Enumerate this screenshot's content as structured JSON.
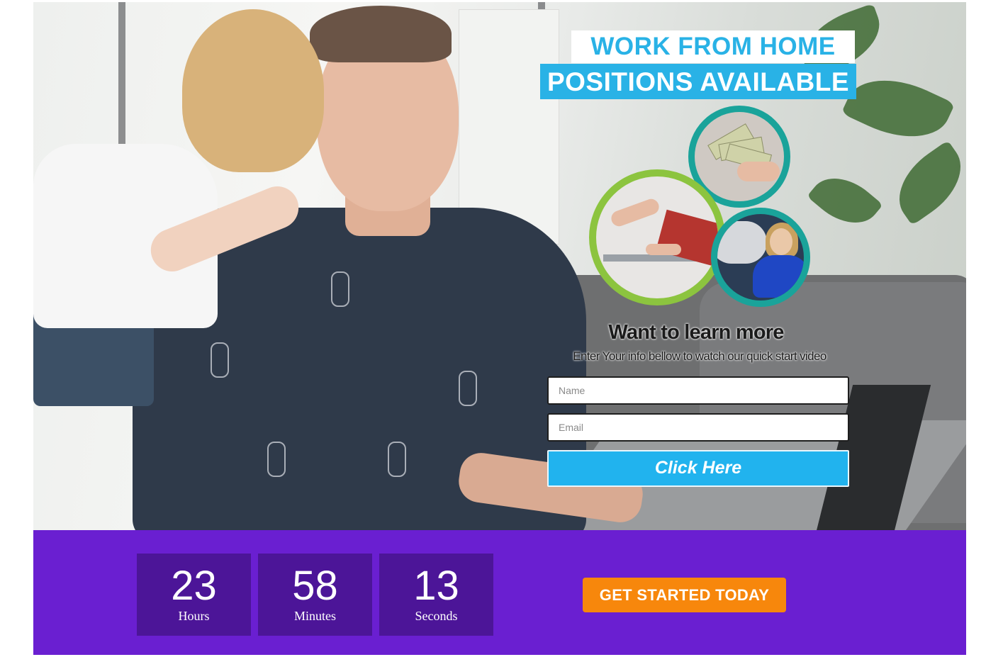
{
  "headline": {
    "line1": "WORK FROM HOME",
    "line2": "POSITIONS AVAILABLE"
  },
  "hero_photo": {
    "icon": "family-photo",
    "circles": [
      "money-photo",
      "relaxing-at-desk-photo",
      "woman-driving-photo"
    ]
  },
  "form": {
    "title": "Want to learn more",
    "subtitle": "Enter Your info bellow to watch our quick start video",
    "name_placeholder": "Name",
    "name_value": "",
    "email_placeholder": "Email",
    "email_value": "",
    "submit_label": "Click Here"
  },
  "countdown": {
    "hours": {
      "value": "23",
      "label": "Hours"
    },
    "minutes": {
      "value": "58",
      "label": "Minutes"
    },
    "seconds": {
      "value": "13",
      "label": "Seconds"
    }
  },
  "cta": {
    "label": "GET STARTED TODAY"
  },
  "colors": {
    "accent_blue": "#29b2e6",
    "band_purple": "#6a1fd1",
    "counter_purple": "#4c1598",
    "cta_orange": "#f7870c",
    "ring_teal": "#1aa39a",
    "ring_green": "#8cc43f"
  }
}
